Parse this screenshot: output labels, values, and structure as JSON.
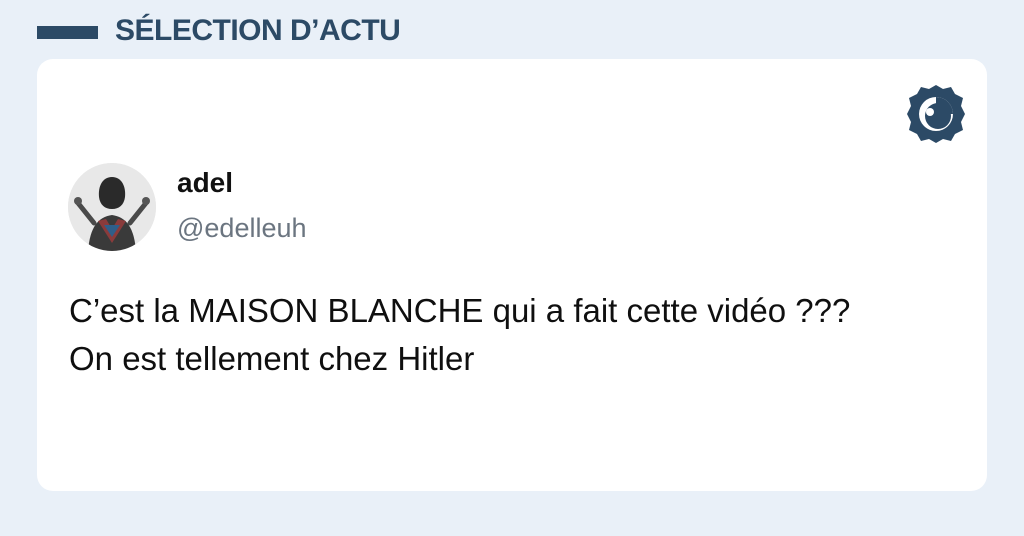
{
  "header": {
    "title": "SÉLECTION D’ACTU",
    "color": "#2c4a66"
  },
  "tweet": {
    "author": {
      "name": "adel",
      "handle": "@edelleuh",
      "avatar_icon": "user-avatar"
    },
    "lines": [
      "C’est la MAISON BLANCHE qui a fait cette vidéo ???",
      "On est tellement chez Hitler"
    ]
  },
  "brand": {
    "icon": "eye-badge-logo",
    "color": "#2c4a66"
  },
  "colors": {
    "background": "#e9f0f8",
    "card": "#ffffff",
    "text": "#0f0f0f",
    "handle": "#6b7580"
  }
}
